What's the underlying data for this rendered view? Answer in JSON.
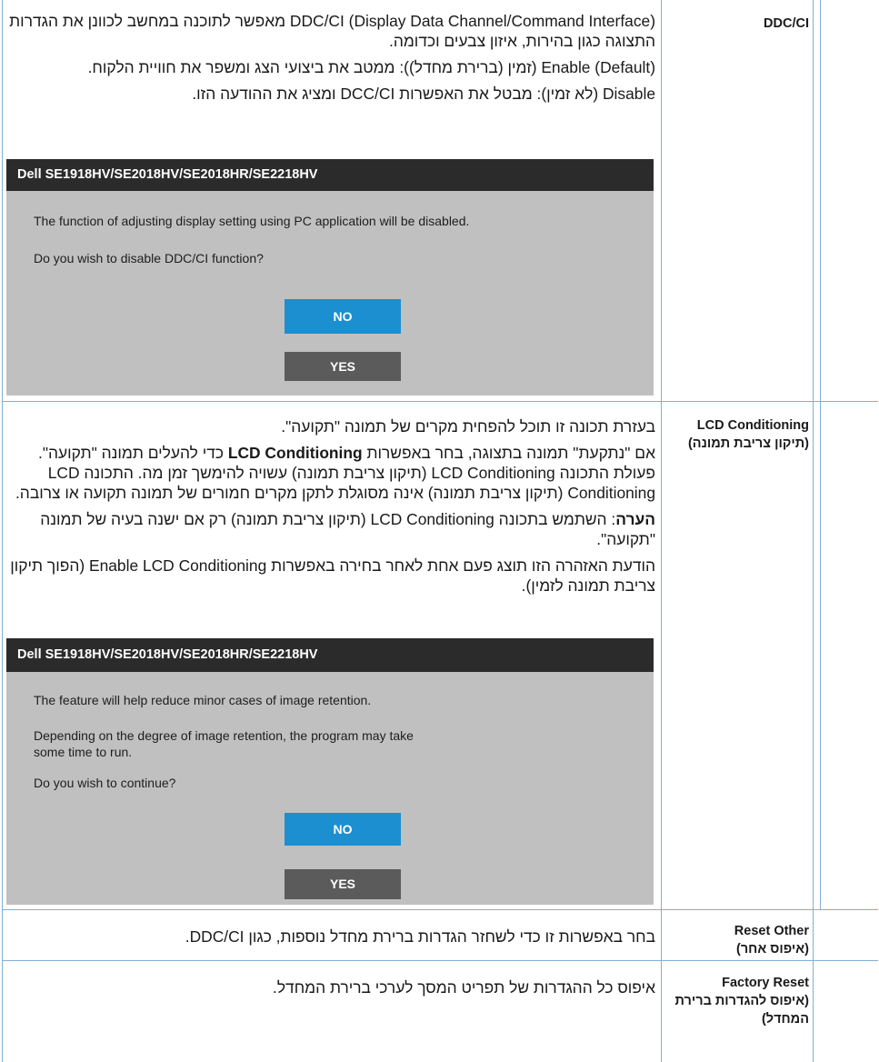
{
  "rows": [
    {
      "label_en": "DDC/CI",
      "label_he": "",
      "paragraphs": [
        "DDC/CI (Display Data Channel/Command Interface) מאפשר לתוכנה במחשב לכוונן את הגדרות התצוגה כגון בהירות, איזון צבעים וכדומה.",
        "Enable (Default) (זמין (ברירת מחדל)): ממטב את ביצועי הצג ומשפר את חוויית הלקוח.",
        "Disable (לא זמין): מבטל את האפשרות DCC/CI ומציג את ההודעה הזו."
      ],
      "dialog": {
        "title": "Dell SE1918HV/SE2018HV/SE2018HR/SE2218HV",
        "lines": [
          "The function of adjusting display setting using PC application will be disabled.",
          "Do you wish to disable DDC/CI function?"
        ],
        "no_label": "NO",
        "yes_label": "YES"
      }
    },
    {
      "label_en": "LCD Conditioning",
      "label_he": "(תיקון צריבת תמונה)",
      "p1": "בעזרת תכונה זו תוכל להפחית מקרים של תמונה \"תקועה\".",
      "p2_pre": "אם \"נתקעת\" תמונה בתצוגה, בחר באפשרות ",
      "p2_bold": "LCD Conditioning",
      "p2_post": " כדי להעלים תמונה \"תקועה\". פעולת התכונה LCD Conditioning (תיקון צריבת תמונה) עשויה להימשך זמן מה. התכונה LCD Conditioning (תיקון צריבת תמונה) אינה מסוגלת לתקן מקרים חמורים של תמונה תקועה או צרובה.",
      "note_bold": "הערה",
      "note_text": ": השתמש בתכונה LCD Conditioning (תיקון צריבת תמונה) רק אם ישנה בעיה של תמונה \"תקועה\".",
      "p4": "הודעת האזהרה הזו תוצג פעם אחת לאחר בחירה באפשרות Enable LCD Conditioning (הפוך תיקון צריבת תמונה לזמין).",
      "dialog": {
        "title": "Dell SE1918HV/SE2018HV/SE2018HR/SE2218HV",
        "line1": "The feature will help reduce minor cases of image retention.",
        "line2a": "Depending on the degree of image retention, the program may take",
        "line2b": "some time to run.",
        "line3": "Do you wish to continue?",
        "no_label": "NO",
        "yes_label": "YES"
      }
    },
    {
      "label_en": "Reset Other",
      "label_he": "(איפוס אחר)",
      "text": "בחר באפשרות זו כדי לשחזר הגדרות ברירת מחדל נוספות, כגון DDC/CI."
    },
    {
      "label_en": "Factory Reset",
      "label_he": "(איפוס להגדרות ברירת המחדל)",
      "text": "איפוס כל ההגדרות של תפריט המסך לערכי ברירת המחדל."
    }
  ]
}
